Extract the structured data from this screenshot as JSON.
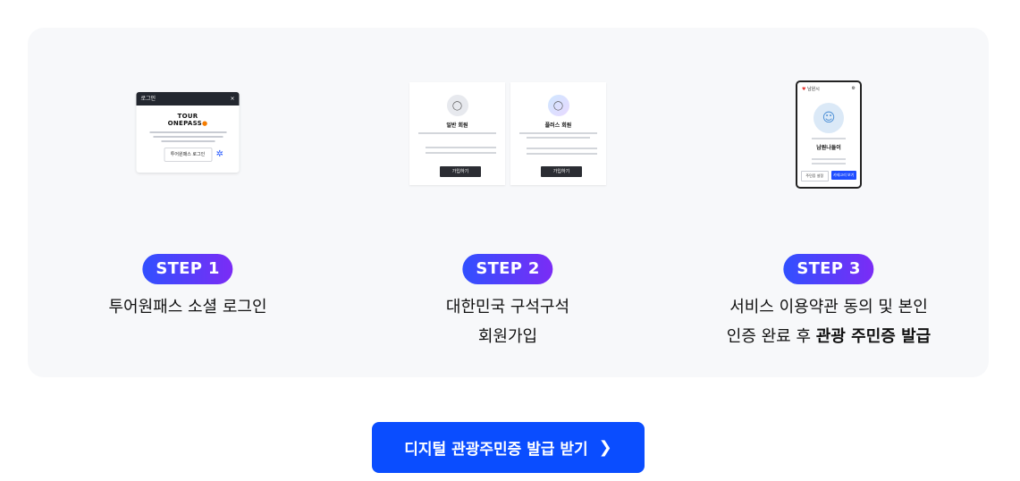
{
  "steps": [
    {
      "badge": "STEP 1",
      "desc_lines": [
        "투어원패스 소셜 로그인"
      ],
      "preview": {
        "bar_title": "로그인",
        "close": "×",
        "logo_line1": "TOUR",
        "logo_line2": "ONEPASS",
        "button": "투어원패스 로그인"
      }
    },
    {
      "badge": "STEP 2",
      "desc_lines": [
        "대한민국 구석구석",
        "회원가입"
      ],
      "preview": {
        "card1_title": "일반 회원",
        "card2_title": "플러스 회원",
        "card_button": "가입하기"
      }
    },
    {
      "badge": "STEP 3",
      "desc_line1": "서비스 이용약관 동의 및 본인",
      "desc_line2_plain": "인증 완료 후 ",
      "desc_line2_bold": "관광 주민증 발급",
      "preview": {
        "city": "남원시",
        "name": "남원나들이",
        "btn_left": "주민증 설정",
        "btn_right": "카테고리 보기"
      }
    }
  ],
  "cta": {
    "label": "디지털 관광주민증 발급 받기",
    "icon": "chevron-right-icon"
  },
  "colors": {
    "badge_gradient_start": "#3150ff",
    "badge_gradient_end": "#7b2cf5",
    "cta": "#0a4dff",
    "panel": "#f7f8fa"
  }
}
